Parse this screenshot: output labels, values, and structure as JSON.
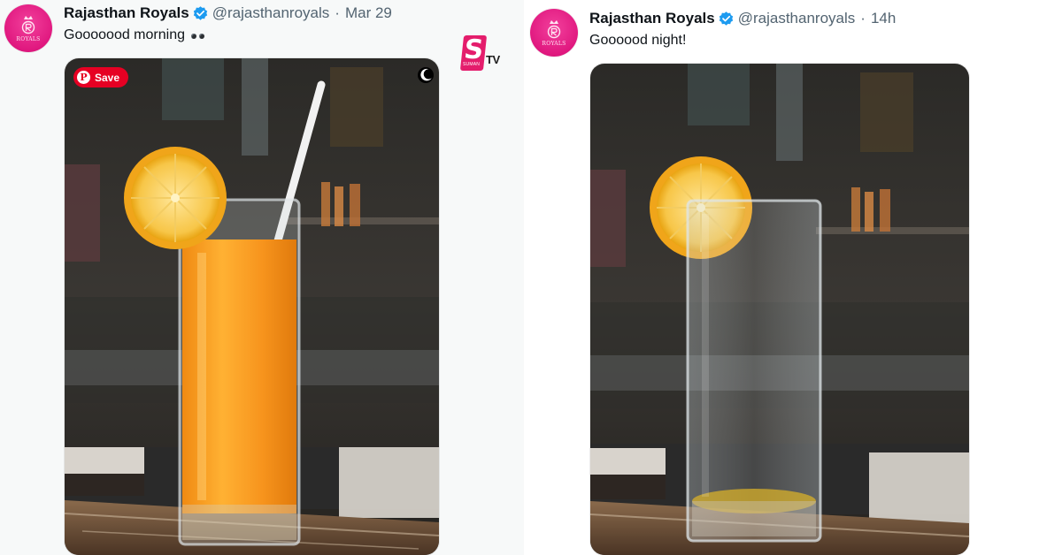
{
  "watermark": {
    "letter": "S",
    "suffix": "TV",
    "sub": "SUMAN"
  },
  "tweets": [
    {
      "author": "Rajasthan Royals",
      "handle": "@rajasthanroyals",
      "separator": "·",
      "time": "Mar 29",
      "text": "Gooooood morning",
      "emoji_icon": "eyes-emoji",
      "avatar_text": "ROYALS",
      "media": {
        "save_label": "Save",
        "pin_glyph": "P"
      }
    },
    {
      "author": "Rajasthan Royals",
      "handle": "@rajasthanroyals",
      "separator": "·",
      "time": "14h",
      "text": "Goooood night!",
      "avatar_text": "ROYALS"
    }
  ],
  "colors": {
    "brand_pink": "#e0187f",
    "verified_blue": "#1d9bf0",
    "pinterest_red": "#e60023",
    "juice_orange": "#f7941d"
  }
}
